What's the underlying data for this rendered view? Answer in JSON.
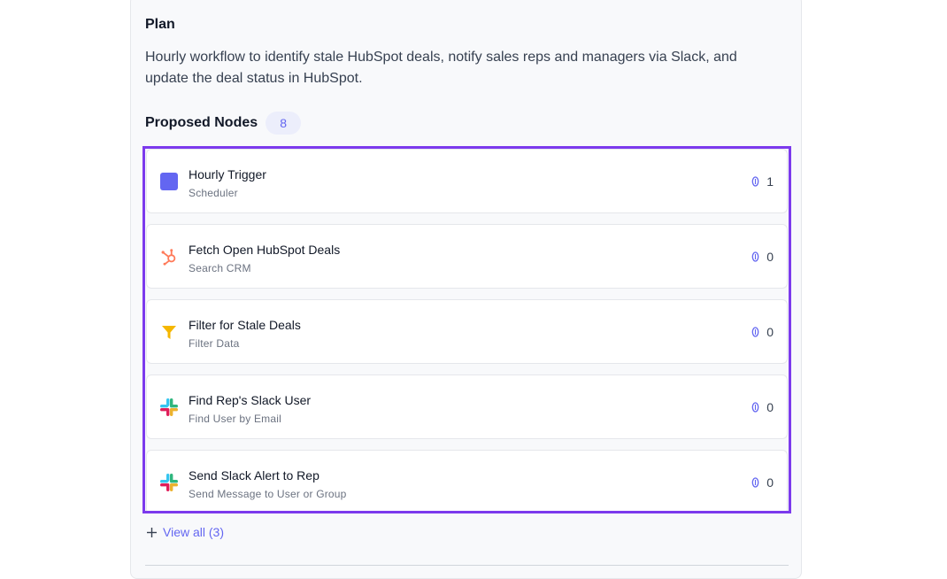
{
  "plan": {
    "title": "Plan",
    "description": "Hourly workflow to identify stale HubSpot deals, notify sales reps and managers via Slack, and update the deal status in HubSpot."
  },
  "nodes": {
    "title": "Proposed Nodes",
    "count": "8",
    "items": [
      {
        "name": "Hourly Trigger",
        "subtitle": "Scheduler",
        "count": "1",
        "icon": "scheduler-icon"
      },
      {
        "name": "Fetch Open HubSpot Deals",
        "subtitle": "Search CRM",
        "count": "0",
        "icon": "hubspot-icon"
      },
      {
        "name": "Filter for Stale Deals",
        "subtitle": "Filter Data",
        "count": "0",
        "icon": "filter-icon"
      },
      {
        "name": "Find Rep's Slack User",
        "subtitle": "Find User by Email",
        "count": "0",
        "icon": "slack-icon"
      },
      {
        "name": "Send Slack Alert to Rep",
        "subtitle": "Send Message to User or Group",
        "count": "0",
        "icon": "slack-icon"
      }
    ],
    "view_all": "View all (3)"
  },
  "colors": {
    "accent": "#6366f1",
    "highlight_border": "#7c3aed",
    "hubspot": "#ff7a59",
    "filter": "#f5b700"
  }
}
